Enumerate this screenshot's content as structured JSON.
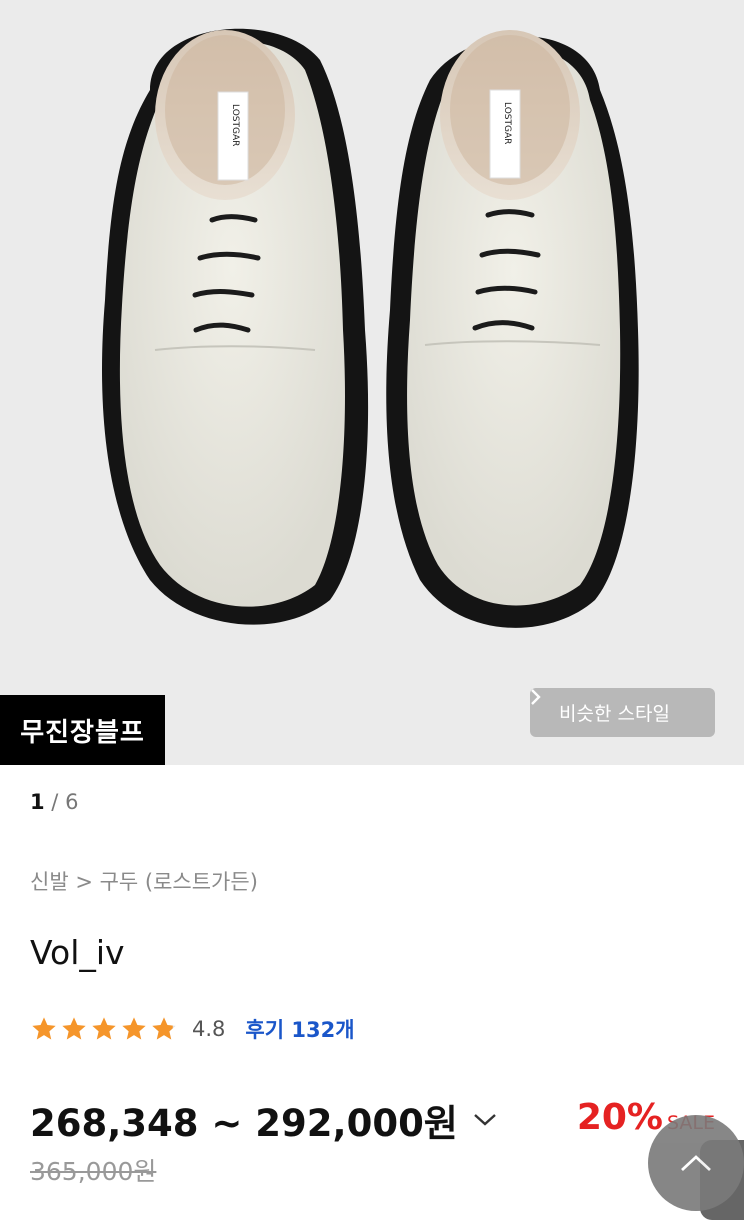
{
  "hero": {
    "image_label": "LOSTGAR",
    "brand_badge": "무진장블프",
    "similar_style_button": "비슷한 스타일",
    "similar_style_icon": "chevron-right-icon"
  },
  "pager": {
    "current": "1",
    "separator": " / ",
    "total": "6"
  },
  "breadcrumb": "신발 > 구두 (로스트가든)",
  "product": {
    "name": "Vol_iv",
    "rating": {
      "stars": 4.8,
      "score": "4.8",
      "reviews_label": "후기 132개"
    },
    "price_range": "268,348 ~ 292,000원",
    "discount_percent": "20%",
    "discount_label": "SALE",
    "original_price": "365,000원"
  },
  "colors": {
    "star": "#f5952a",
    "review_link": "#1a56c9",
    "discount": "#e52222"
  }
}
